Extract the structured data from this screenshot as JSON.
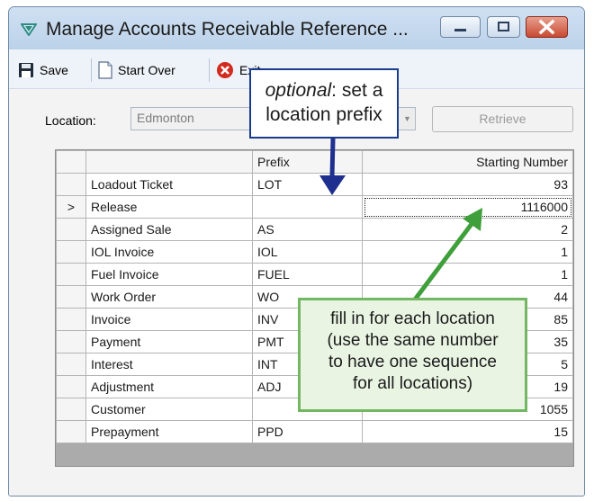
{
  "window": {
    "title": "Manage Accounts Receivable Reference ...",
    "icons": {
      "app": "down-triangle-app-icon",
      "minimize": "minimize-icon",
      "maximize": "maximize-icon",
      "close": "close-icon"
    }
  },
  "toolbar": {
    "save_label": "Save",
    "start_over_label": "Start Over",
    "exit_label": "Exit",
    "icons": {
      "save": "floppy-disk-icon",
      "start_over": "blank-page-icon",
      "exit": "red-x-circle-icon"
    }
  },
  "location": {
    "label": "Location:",
    "value": "Edmonton",
    "dropdown_icon": "chevron-down-icon",
    "retrieve_label": "Retrieve"
  },
  "grid": {
    "headers": {
      "prefix": "Prefix",
      "starting_number": "Starting Number"
    },
    "current_row_marker": ">",
    "rows": [
      {
        "name": "Loadout Ticket",
        "prefix": "LOT",
        "starting_number": "93"
      },
      {
        "name": "Release",
        "prefix": "",
        "starting_number": "1116000"
      },
      {
        "name": "Assigned Sale",
        "prefix": "AS",
        "starting_number": "2"
      },
      {
        "name": "IOL Invoice",
        "prefix": "IOL",
        "starting_number": "1"
      },
      {
        "name": "Fuel Invoice",
        "prefix": "FUEL",
        "starting_number": "1"
      },
      {
        "name": "Work Order",
        "prefix": "WO",
        "starting_number": "44"
      },
      {
        "name": "Invoice",
        "prefix": "INV",
        "starting_number": "85"
      },
      {
        "name": "Payment",
        "prefix": "PMT",
        "starting_number": "35"
      },
      {
        "name": "Interest",
        "prefix": "INT",
        "starting_number": "5"
      },
      {
        "name": "Adjustment",
        "prefix": "ADJ",
        "starting_number": "19"
      },
      {
        "name": "Customer",
        "prefix": "",
        "starting_number": "1055"
      },
      {
        "name": "Prepayment",
        "prefix": "PPD",
        "starting_number": "15"
      }
    ]
  },
  "annotations": {
    "prefix_callout": {
      "italic": "optional",
      "rest_line1": ": set a",
      "line2": "location prefix",
      "color": "#1a3c8c"
    },
    "number_callout": {
      "lines": [
        "fill in for each location",
        "(use the same number",
        "to have one sequence",
        "for all locations)"
      ],
      "color": "#73b763"
    }
  },
  "colors": {
    "title_bar": "#cfe0f2",
    "close_button": "#c84a32",
    "blue_arrow": "#1f2f8f",
    "green_arrow": "#3f9f3a"
  }
}
